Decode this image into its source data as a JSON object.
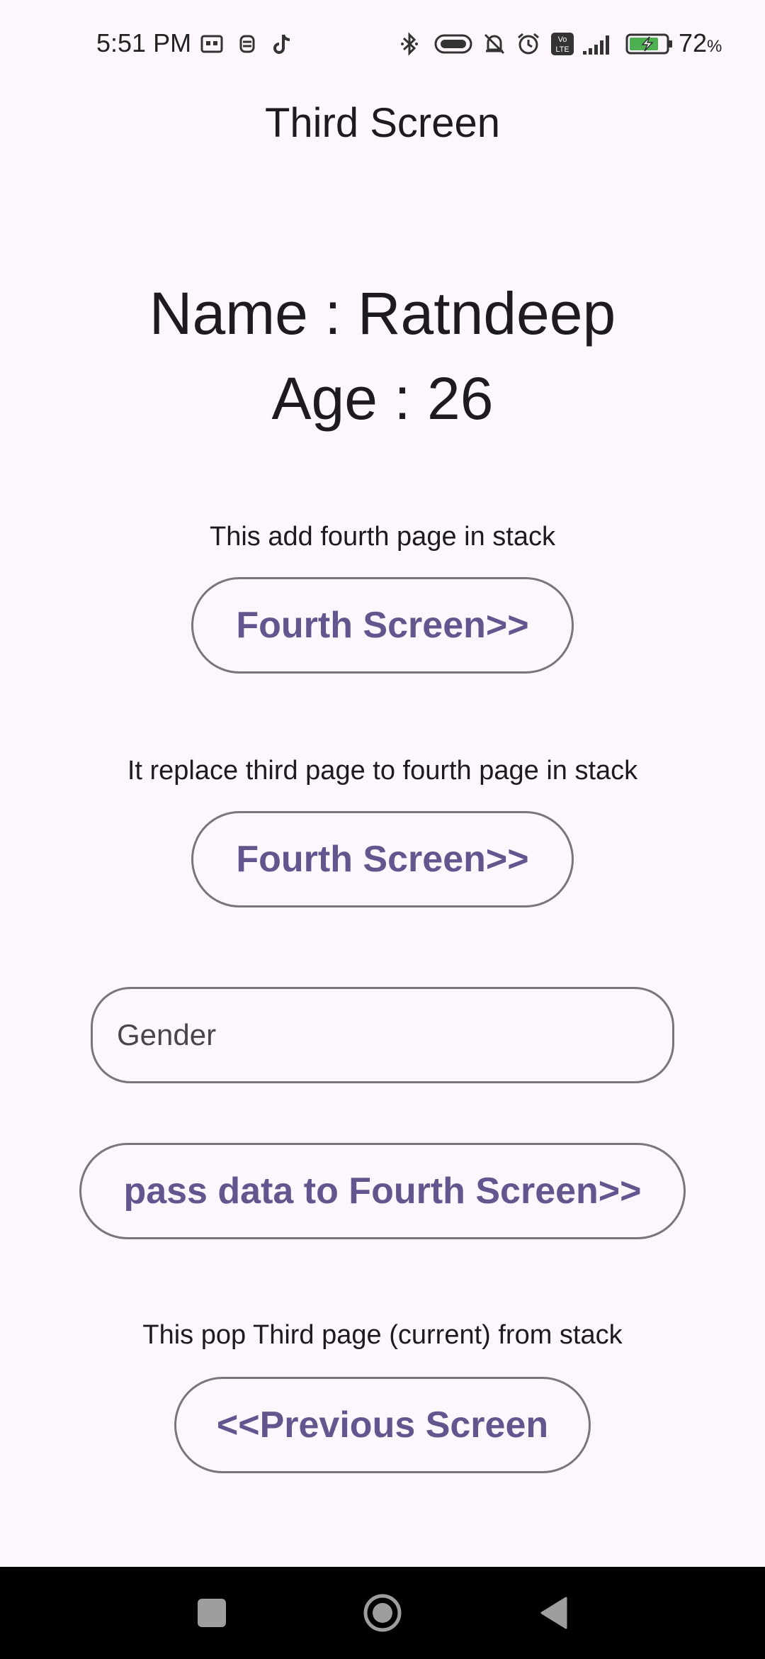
{
  "status_bar": {
    "time": "5:51 PM",
    "battery_percent": "72",
    "battery_unit": "%",
    "icons_left": [
      "cast-icon",
      "robot-icon",
      "tiktok-icon"
    ],
    "icons_right": [
      "bluetooth-icon",
      "link-pill-icon",
      "bell-off-icon",
      "alarm-icon",
      "volte-icon",
      "signal-icon",
      "battery-charging-icon"
    ]
  },
  "app_bar": {
    "title": "Third Screen"
  },
  "main": {
    "name_line": "Name : Ratndeep",
    "age_line": "Age : 26",
    "push_desc": "This add fourth page in stack",
    "push_button": "Fourth Screen>>",
    "replace_desc": "It replace third page to fourth page in stack",
    "replace_button": "Fourth Screen>>",
    "gender_field": {
      "placeholder": "Gender",
      "value": ""
    },
    "pass_data_button": "pass data to Fourth Screen>>",
    "pop_desc": "This pop Third page (current) from stack",
    "previous_button": "<<Previous Screen"
  },
  "nav_bar": {
    "buttons": [
      "recents-square-icon",
      "home-circle-icon",
      "back-triangle-icon"
    ]
  },
  "colors": {
    "background": "#fdf7fd",
    "accent": "#65558f",
    "outline": "#79747e",
    "text": "#1d1b20"
  }
}
